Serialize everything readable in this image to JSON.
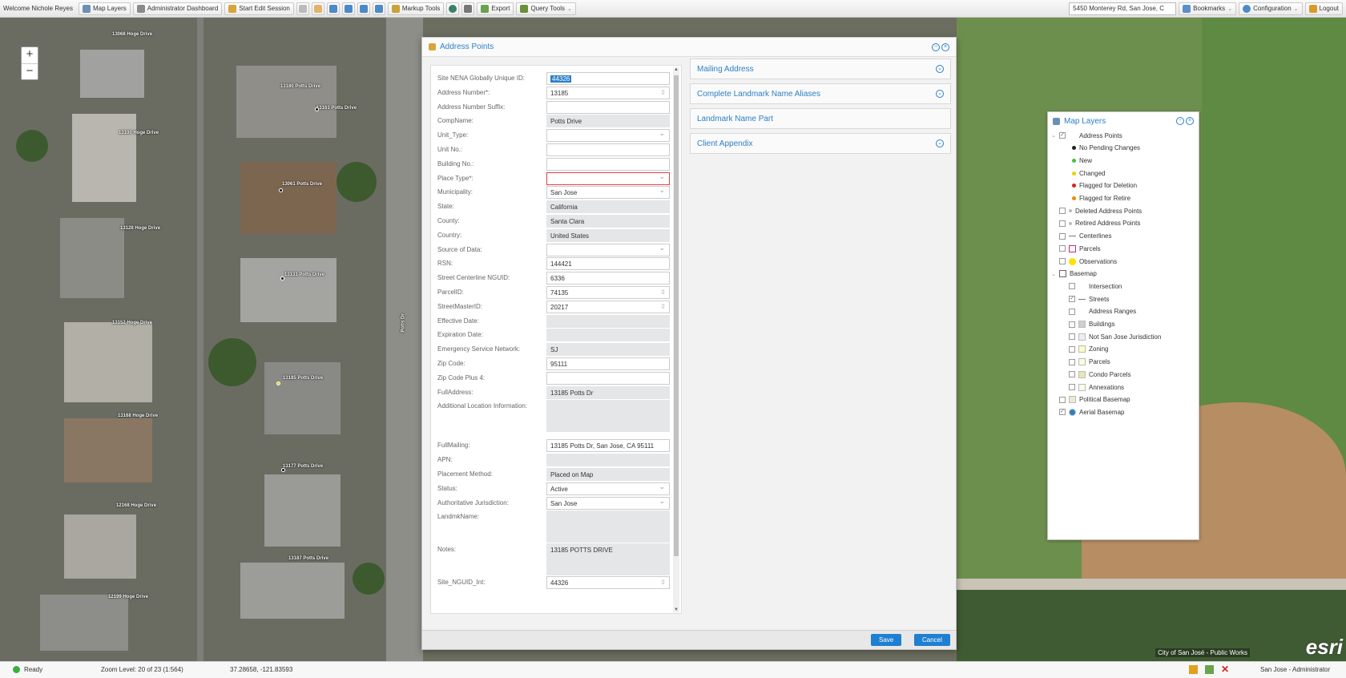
{
  "toolbar": {
    "welcome": "Welcome Nichole Reyes",
    "map_layers": "Map Layers",
    "admin_dashboard": "Administrator Dashboard",
    "start_edit": "Start Edit Session",
    "markup_tools": "Markup Tools",
    "export": "Export",
    "query_tools": "Query Tools",
    "search_value": "5450 Monterey Rd, San Jose, C",
    "bookmarks": "Bookmarks",
    "configuration": "Configuration",
    "logout": "Logout"
  },
  "map": {
    "zoom_in": "+",
    "zoom_out": "−",
    "attribution": "City of San José - Public Works",
    "esri": "esri",
    "street_label": "Potts Dr",
    "labels": [
      "13068 Hoge Drive",
      "13180 Potts Drive",
      "13161 Potts Drive",
      "13100 Hoge Drive",
      "13061 Potts Drive",
      "13128 Hoge Drive",
      "13131 Potts Drive",
      "13152 Hoge Drive",
      "13185 Potts Drive",
      "13168 Hoge Drive",
      "13177 Potts Drive",
      "12168 Hoge Drive",
      "13187 Potts Drive",
      "12199 Hoge Drive"
    ]
  },
  "dialog": {
    "title": "Address Points",
    "fields": [
      {
        "label": "Site NENA Globally Unique ID:",
        "value": "44326",
        "kind": "sel"
      },
      {
        "label": "Address Number*:",
        "value": "13185",
        "kind": "spin"
      },
      {
        "label": "Address Number Suffix:",
        "value": "",
        "kind": "text"
      },
      {
        "label": "CompName:",
        "value": "Potts Drive",
        "kind": "ro"
      },
      {
        "label": "Unit_Type:",
        "value": "",
        "kind": "dd"
      },
      {
        "label": "Unit No.:",
        "value": "",
        "kind": "text"
      },
      {
        "label": "Building No.:",
        "value": "",
        "kind": "text"
      },
      {
        "label": "Place Type*:",
        "value": "",
        "kind": "err"
      },
      {
        "label": "Municipality:",
        "value": "San Jose",
        "kind": "dd"
      },
      {
        "label": "State:",
        "value": "California",
        "kind": "ro"
      },
      {
        "label": "County:",
        "value": "Santa Clara",
        "kind": "ro"
      },
      {
        "label": "Country:",
        "value": "United States",
        "kind": "ro"
      },
      {
        "label": "Source of Data:",
        "value": "",
        "kind": "dd"
      },
      {
        "label": "RSN:",
        "value": "144421",
        "kind": "text"
      },
      {
        "label": "Street Centerline NGUID:",
        "value": "6336",
        "kind": "text"
      },
      {
        "label": "ParcelID:",
        "value": "74135",
        "kind": "spin"
      },
      {
        "label": "StreetMasterID:",
        "value": "20217",
        "kind": "spin"
      },
      {
        "label": "Effective Date:",
        "value": "",
        "kind": "ro"
      },
      {
        "label": "Expiration Date:",
        "value": "",
        "kind": "ro"
      },
      {
        "label": "Emergency Service Network:",
        "value": "SJ",
        "kind": "ro"
      },
      {
        "label": "Zip Code:",
        "value": "95111",
        "kind": "text"
      },
      {
        "label": "Zip Code Plus 4:",
        "value": "",
        "kind": "text"
      },
      {
        "label": "FullAddress:",
        "value": "13185 Potts Dr",
        "kind": "ro"
      },
      {
        "label": "Additional Location Information:",
        "value": "",
        "kind": "ro-tall"
      },
      {
        "label": "FullMailing:",
        "value": "13185 Potts Dr, San Jose, CA 95111",
        "kind": "text"
      },
      {
        "label": "APN:",
        "value": "",
        "kind": "ro"
      },
      {
        "label": "Placement Method:",
        "value": "Placed on Map",
        "kind": "ro"
      },
      {
        "label": "Status:",
        "value": "Active",
        "kind": "dd"
      },
      {
        "label": "Authoritative Jurisdiction:",
        "value": "San Jose",
        "kind": "dd"
      },
      {
        "label": "LandmkName:",
        "value": "",
        "kind": "ro-tall"
      },
      {
        "label": "Notes:",
        "value": "13185 POTTS DRIVE",
        "kind": "ro-tall"
      },
      {
        "label": "Site_NGUID_Int:",
        "value": "44326",
        "kind": "spin"
      }
    ],
    "sections": [
      "Mailing Address",
      "Complete Landmark Name Aliases",
      "Landmark Name Part",
      "Client Appendix"
    ],
    "save": "Save",
    "cancel": "Cancel"
  },
  "layers": {
    "title": "Map Layers",
    "items": [
      {
        "label": "Address Points",
        "checked": true,
        "level": 0
      },
      {
        "label": "No Pending Changes",
        "color": "#222222",
        "level": 1
      },
      {
        "label": "New",
        "color": "#3cc43c",
        "level": 1
      },
      {
        "label": "Changed",
        "color": "#e8d400",
        "level": 1
      },
      {
        "label": "Flagged for Deletion",
        "color": "#d81e1e",
        "level": 1
      },
      {
        "label": "Flagged for Retire",
        "color": "#f08a00",
        "level": 1
      },
      {
        "label": "Deleted Address Points",
        "checked": false,
        "level": 0
      },
      {
        "label": "Retired Address Points",
        "checked": false,
        "level": 0
      },
      {
        "label": "Centerlines",
        "checked": false,
        "level": 0
      },
      {
        "label": "Parcels",
        "checked": false,
        "level": 0
      },
      {
        "label": "Observations",
        "checked": false,
        "level": 0
      },
      {
        "label": "Basemap",
        "level": 0
      },
      {
        "label": "Intersection",
        "checked": false,
        "level": 2
      },
      {
        "label": "Streets",
        "checked": true,
        "level": 2
      },
      {
        "label": "Address Ranges",
        "checked": false,
        "level": 2
      },
      {
        "label": "Buildings",
        "checked": false,
        "level": 2
      },
      {
        "label": "Not San Jose Jurisdiction",
        "checked": false,
        "level": 2
      },
      {
        "label": "Zoning",
        "checked": false,
        "level": 2
      },
      {
        "label": "Parcels",
        "checked": false,
        "level": 2
      },
      {
        "label": "Condo Parcels",
        "checked": false,
        "level": 2
      },
      {
        "label": "Annexations",
        "checked": false,
        "level": 2
      },
      {
        "label": "Political Basemap",
        "checked": false,
        "level": 0
      },
      {
        "label": "Aerial Basemap",
        "checked": true,
        "level": 0
      }
    ]
  },
  "status": {
    "ready": "Ready",
    "zoom": "Zoom Level: 20 of 23 (1:564)",
    "coords": "37.28658, -121.83593",
    "user": "San Jose - Administrator"
  }
}
